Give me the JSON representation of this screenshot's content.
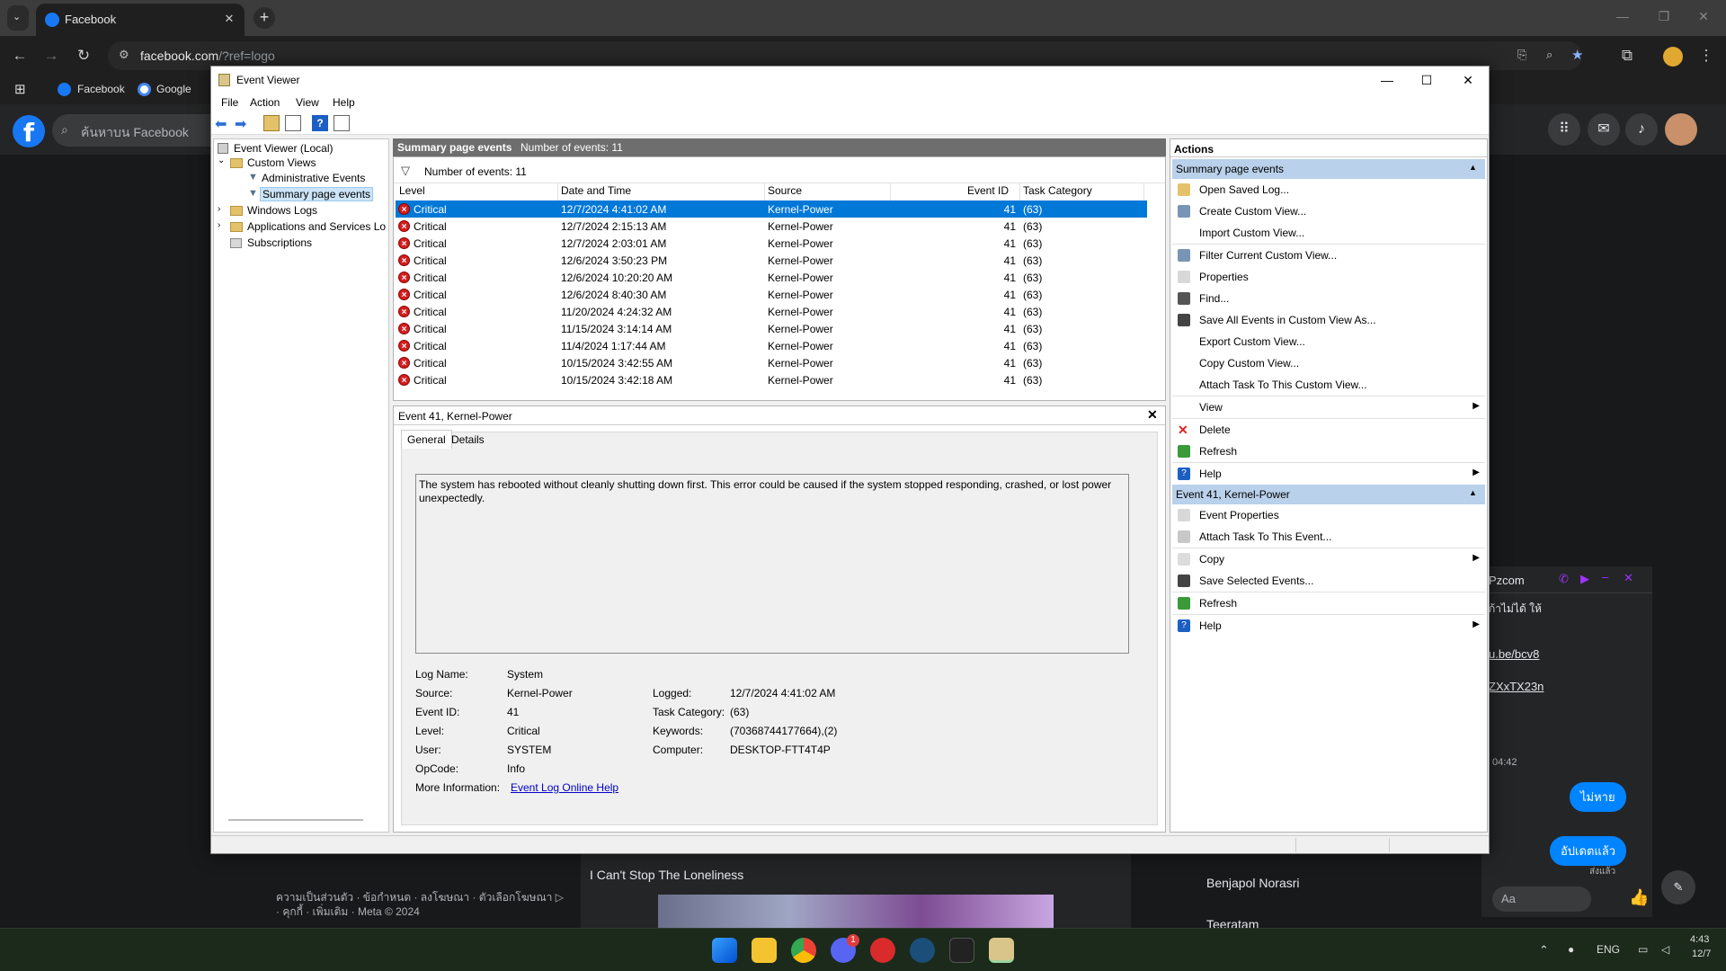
{
  "browser": {
    "tab_title": "Facebook",
    "tab_close": "✕",
    "url_host": "facebook.com",
    "url_path": "/?ref=logo",
    "bookmarks": [
      "Facebook",
      "Google"
    ]
  },
  "facebook": {
    "search_placeholder": "ค้นหาบน Facebook",
    "footer": "ความเป็นส่วนตัว · ข้อกำหนด · ลงโฆษณา · ตัวเลือกโฆษณา ▷ · คุกกี้ · เพิ่มเติม · Meta © 2024",
    "post_title": "I Can't Stop The Loneliness",
    "contacts": [
      "Benjapol Norasri",
      "Teeratam"
    ]
  },
  "messenger": {
    "chat_name": "Pzcom",
    "snippet_1": "ก้าไม่ได้ ให้",
    "link_1": "u.be/bcv8",
    "link_2": "ZXxTX23n",
    "time": "04:42",
    "bubble_1": "ไม่หาย",
    "bubble_2": "อัปเดตแล้ว",
    "sent_label": "ส่งแล้ว",
    "input_placeholder": "Aa"
  },
  "taskbar": {
    "lang": "ENG",
    "time": "4:43",
    "date": "12/7",
    "discord_badge": "1"
  },
  "eventviewer": {
    "title": "Event Viewer",
    "menu": [
      "File",
      "Action",
      "View",
      "Help"
    ],
    "tree": {
      "root": "Event Viewer (Local)",
      "custom_views": "Custom Views",
      "admin_events": "Administrative Events",
      "summary_events": "Summary page events",
      "windows_logs": "Windows Logs",
      "apps_services": "Applications and Services Lo",
      "subscriptions": "Subscriptions"
    },
    "header_name": "Summary page events",
    "header_count": "Number of events: 11",
    "filter_count": "Number of events: 11",
    "columns": [
      "Level",
      "Date and Time",
      "Source",
      "Event ID",
      "Task Category"
    ],
    "events": [
      {
        "level": "Critical",
        "datetime": "12/7/2024 4:41:02 AM",
        "source": "Kernel-Power",
        "id": "41",
        "category": "(63)"
      },
      {
        "level": "Critical",
        "datetime": "12/7/2024 2:15:13 AM",
        "source": "Kernel-Power",
        "id": "41",
        "category": "(63)"
      },
      {
        "level": "Critical",
        "datetime": "12/7/2024 2:03:01 AM",
        "source": "Kernel-Power",
        "id": "41",
        "category": "(63)"
      },
      {
        "level": "Critical",
        "datetime": "12/6/2024 3:50:23 PM",
        "source": "Kernel-Power",
        "id": "41",
        "category": "(63)"
      },
      {
        "level": "Critical",
        "datetime": "12/6/2024 10:20:20 AM",
        "source": "Kernel-Power",
        "id": "41",
        "category": "(63)"
      },
      {
        "level": "Critical",
        "datetime": "12/6/2024 8:40:30 AM",
        "source": "Kernel-Power",
        "id": "41",
        "category": "(63)"
      },
      {
        "level": "Critical",
        "datetime": "11/20/2024 4:24:32 AM",
        "source": "Kernel-Power",
        "id": "41",
        "category": "(63)"
      },
      {
        "level": "Critical",
        "datetime": "11/15/2024 3:14:14 AM",
        "source": "Kernel-Power",
        "id": "41",
        "category": "(63)"
      },
      {
        "level": "Critical",
        "datetime": "11/4/2024 1:17:44 AM",
        "source": "Kernel-Power",
        "id": "41",
        "category": "(63)"
      },
      {
        "level": "Critical",
        "datetime": "10/15/2024 3:42:55 AM",
        "source": "Kernel-Power",
        "id": "41",
        "category": "(63)"
      },
      {
        "level": "Critical",
        "datetime": "10/15/2024 3:42:18 AM",
        "source": "Kernel-Power",
        "id": "41",
        "category": "(63)"
      }
    ],
    "selected_index": 0,
    "detail": {
      "title": "Event 41, Kernel-Power",
      "tabs": [
        "General",
        "Details"
      ],
      "description": "The system has rebooted without cleanly shutting down first. This error could be caused if the system stopped responding, crashed, or lost power unexpectedly.",
      "log_name_label": "Log Name:",
      "log_name": "System",
      "source_label": "Source:",
      "source": "Kernel-Power",
      "logged_label": "Logged:",
      "logged": "12/7/2024 4:41:02 AM",
      "event_id_label": "Event ID:",
      "event_id": "41",
      "task_cat_label": "Task Category:",
      "task_cat": "(63)",
      "level_label": "Level:",
      "level": "Critical",
      "keywords_label": "Keywords:",
      "keywords": "(70368744177664),(2)",
      "user_label": "User:",
      "user": "SYSTEM",
      "computer_label": "Computer:",
      "computer": "DESKTOP-FTT4T4P",
      "opcode_label": "OpCode:",
      "opcode": "Info",
      "more_info_label": "More Information:",
      "more_info_link": "Event Log Online Help"
    },
    "actions": {
      "title": "Actions",
      "section1": "Summary page events",
      "items1": [
        "Open Saved Log...",
        "Create Custom View...",
        "Import Custom View...",
        "Filter Current Custom View...",
        "Properties",
        "Find...",
        "Save All Events in Custom View As...",
        "Export Custom View...",
        "Copy Custom View...",
        "Attach Task To This Custom View...",
        "View",
        "Delete",
        "Refresh",
        "Help"
      ],
      "section2": "Event 41, Kernel-Power",
      "items2": [
        "Event Properties",
        "Attach Task To This Event...",
        "Copy",
        "Save Selected Events...",
        "Refresh",
        "Help"
      ]
    },
    "colors": {
      "selection": "#0078d7",
      "section": "#b9d1ea",
      "critical": "#d21f1f"
    }
  }
}
